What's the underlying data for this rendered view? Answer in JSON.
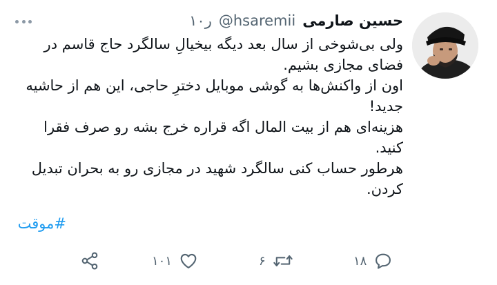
{
  "tweet": {
    "author_name": "حسین صارمی",
    "handle": "@hsaremii",
    "time": "۱۰ر",
    "paragraphs": [
      "ولی بی‌شوخی از سال بعد دیگه بیخیالِ سالگرد حاج قاسم در فضای مجازی بشیم.",
      "اون از واکنش‌ها به گوشی موبایل دخترِ حاجی، این هم از حاشیه جدید!",
      "هزینه‌ای هم از بیت المال اگه قراره خرج بشه رو صرف فقرا کنید.",
      "هرطور حساب کنی سالگرد شهید در مجازی رو به بحران تبدیل کردن."
    ],
    "hashtag": "#موقت",
    "actions": {
      "reply_count": "۱۸",
      "retweet_count": "۶",
      "like_count": "۱۰۱"
    }
  },
  "icons": {
    "menu": "more-dots-icon",
    "reply": "reply-icon",
    "retweet": "retweet-icon",
    "like": "heart-icon",
    "share": "share-icon"
  },
  "colors": {
    "text": "#0f1419",
    "secondary": "#536471",
    "hashtag": "#1d9bf0"
  }
}
